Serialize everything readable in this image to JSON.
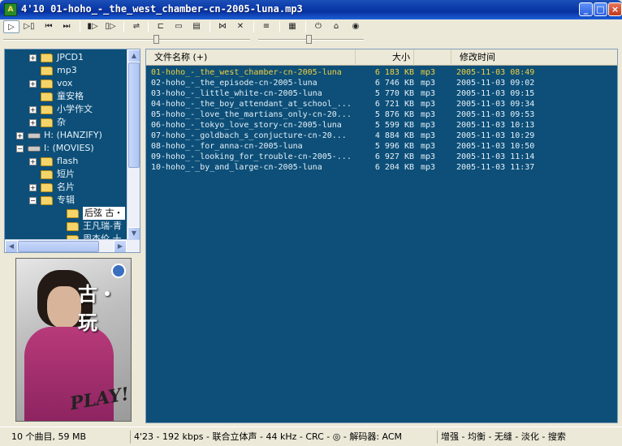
{
  "window": {
    "title": "4'10 01-hoho_-_the_west_chamber-cn-2005-luna.mp3",
    "app_icon_text": "A",
    "buttons": {
      "minimize": "_",
      "maximize": "□",
      "close": "×"
    }
  },
  "toolbar": {
    "buttons": [
      {
        "name": "play-icon",
        "glyph": "▷"
      },
      {
        "name": "play-next-icon",
        "glyph": "▷▯"
      },
      {
        "name": "prev-track-icon",
        "glyph": "⏮"
      },
      {
        "name": "next-track-icon",
        "glyph": "⏭"
      },
      {
        "name": "open-file-icon",
        "glyph": "▮▷"
      },
      {
        "name": "open-folder-icon",
        "glyph": "▯▷"
      },
      {
        "name": "shuffle-icon",
        "glyph": "⇌"
      },
      {
        "name": "settings-icon",
        "glyph": "⊏"
      },
      {
        "name": "window-icon",
        "glyph": "▭"
      },
      {
        "name": "copy-icon",
        "glyph": "▤"
      },
      {
        "name": "equalizer-icon",
        "glyph": "⋈"
      },
      {
        "name": "delete-icon",
        "glyph": "✕"
      },
      {
        "name": "align-icon",
        "glyph": "≡"
      },
      {
        "name": "document-icon",
        "glyph": "▦"
      },
      {
        "name": "power-icon",
        "glyph": "⏻"
      },
      {
        "name": "home-icon",
        "glyph": "⌂"
      },
      {
        "name": "globe-icon",
        "glyph": "◉"
      }
    ],
    "volume_level": 0.62,
    "balance_level": 0.48
  },
  "tree": {
    "items": [
      {
        "label": "JPCD1",
        "type": "folder",
        "depth": 3,
        "expander": "+"
      },
      {
        "label": "mp3",
        "type": "folder",
        "depth": 3,
        "expander": ""
      },
      {
        "label": "vox",
        "type": "folder",
        "depth": 3,
        "expander": "+"
      },
      {
        "label": "童安格",
        "type": "folder",
        "depth": 3,
        "expander": ""
      },
      {
        "label": "小学作文",
        "type": "folder",
        "depth": 3,
        "expander": "+"
      },
      {
        "label": "杂",
        "type": "folder",
        "depth": 3,
        "expander": "+"
      },
      {
        "label": "H: (HANZIFY)",
        "type": "drive",
        "depth": 1,
        "expander": "+"
      },
      {
        "label": "I: (MOVIES)",
        "type": "drive",
        "depth": 1,
        "expander": "−"
      },
      {
        "label": "flash",
        "type": "folder",
        "depth": 3,
        "expander": "+"
      },
      {
        "label": "短片",
        "type": "folder",
        "depth": 3,
        "expander": ""
      },
      {
        "label": "名片",
        "type": "folder",
        "depth": 3,
        "expander": "+"
      },
      {
        "label": "专辑",
        "type": "folder",
        "depth": 3,
        "expander": "−"
      },
      {
        "label": "后弦 古・",
        "type": "folder",
        "depth": 5,
        "expander": "",
        "selected": true
      },
      {
        "label": "王凡瑞-青",
        "type": "folder",
        "depth": 5,
        "expander": ""
      },
      {
        "label": "周杰伦 十",
        "type": "folder",
        "depth": 5,
        "expander": ""
      }
    ],
    "scroll_up": "▲",
    "scroll_down": "▼",
    "scroll_left": "◀",
    "scroll_right": "▶"
  },
  "cover": {
    "title_text": "古・玩"
  },
  "list": {
    "columns": {
      "name": "文件名称 (+)",
      "size": "大小",
      "modified": "修改时间"
    },
    "rows": [
      {
        "name": "01-hoho_-_the_west_chamber-cn-2005-luna",
        "size": "6 183 KB",
        "type": "mp3",
        "date": "2005-11-03 08:49",
        "playing": true
      },
      {
        "name": "02-hoho_-_the_episode-cn-2005-luna",
        "size": "6 746 KB",
        "type": "mp3",
        "date": "2005-11-03 09:02"
      },
      {
        "name": "03-hoho_-_little_white-cn-2005-luna",
        "size": "5 770 KB",
        "type": "mp3",
        "date": "2005-11-03 09:15"
      },
      {
        "name": "04-hoho_-_the_boy_attendant_at_school_...",
        "size": "6 721 KB",
        "type": "mp3",
        "date": "2005-11-03 09:34"
      },
      {
        "name": "05-hoho_-_love_the_martians_only-cn-20...",
        "size": "5 876 KB",
        "type": "mp3",
        "date": "2005-11-03 09:53"
      },
      {
        "name": "06-hoho_-_tokyo_love_story-cn-2005-luna",
        "size": "5 599 KB",
        "type": "mp3",
        "date": "2005-11-03 10:13"
      },
      {
        "name": "07-hoho_-_goldbach_s_conjucture-cn-20...",
        "size": "4 884 KB",
        "type": "mp3",
        "date": "2005-11-03 10:29"
      },
      {
        "name": "08-hoho_-_for_anna-cn-2005-luna",
        "size": "5 996 KB",
        "type": "mp3",
        "date": "2005-11-03 10:50"
      },
      {
        "name": "09-hoho_-_looking_for_trouble-cn-2005-...",
        "size": "6 927 KB",
        "type": "mp3",
        "date": "2005-11-03 11:14"
      },
      {
        "name": "10-hoho_-_by_and_large-cn-2005-luna",
        "size": "6 204 KB",
        "type": "mp3",
        "date": "2005-11-03 11:37"
      }
    ]
  },
  "status": {
    "summary": "10 个曲目, 59 MB",
    "track_info": "4'23 - 192 kbps - 联合立体声 - 44 kHz - CRC - ◎ - 解码器: ACM",
    "options": "增强 - 均衡 - 无缝 - 淡化 - 搜索"
  },
  "colors": {
    "panel_bg": "#0d4f78",
    "playing_text": "#f2d040",
    "list_text": "#e6f0f8"
  }
}
